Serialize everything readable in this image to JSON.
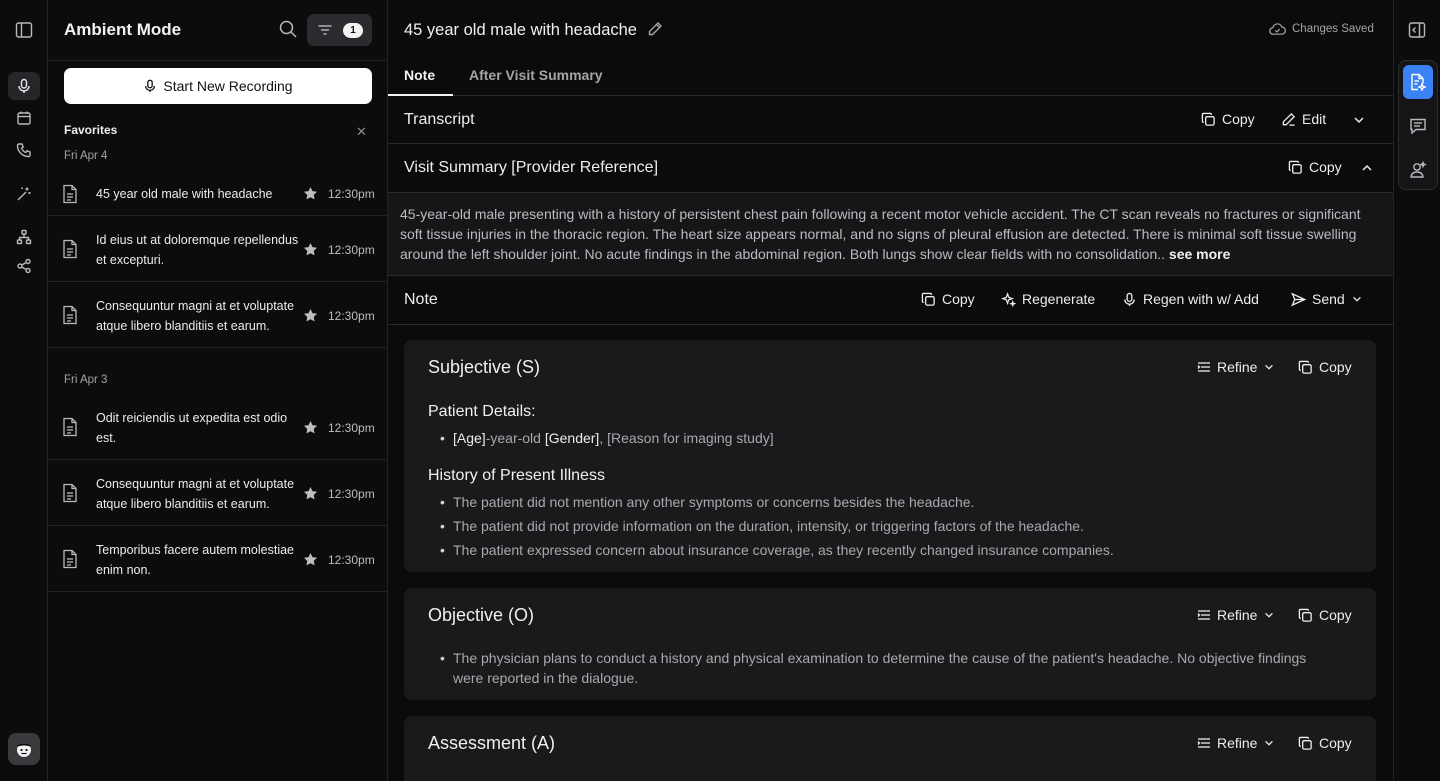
{
  "left_rail": {
    "icons": [
      "sidebar-toggle-icon",
      "microphone-icon",
      "calendar-icon",
      "phone-icon",
      "magic-wand-icon",
      "sitemap-icon",
      "share-icon",
      "avatar-icon"
    ]
  },
  "panel": {
    "title": "Ambient Mode",
    "filter_count": "1",
    "record_button": "Start New Recording",
    "favorites_label": "Favorites",
    "groups": [
      {
        "date": "Fri Apr 4",
        "items": [
          {
            "text": "45 year old male with headache",
            "time": "12:30pm"
          },
          {
            "text": "Id eius ut at doloremque repellendus et excepturi.",
            "time": "12:30pm"
          },
          {
            "text": "Consequuntur magni at et voluptate atque libero blanditiis et earum.",
            "time": "12:30pm"
          }
        ]
      },
      {
        "date": "Fri Apr 3",
        "items": [
          {
            "text": "Odit reiciendis ut expedita est odio est.",
            "time": "12:30pm"
          },
          {
            "text": "Consequuntur magni at et voluptate atque libero blanditiis et earum.",
            "time": "12:30pm"
          },
          {
            "text": "Temporibus facere autem molestiae enim non.",
            "time": "12:30pm"
          }
        ]
      }
    ]
  },
  "main": {
    "title": "45 year old male with headache",
    "saved_status": "Changes Saved",
    "tabs": [
      {
        "label": "Note"
      },
      {
        "label": "After Visit Summary"
      }
    ],
    "transcript": {
      "title": "Transcript",
      "copy": "Copy",
      "edit": "Edit"
    },
    "visit_summary": {
      "title": "Visit Summary [Provider Reference]",
      "copy": "Copy",
      "text": "45-year-old male presenting with a history of persistent chest pain following a recent motor vehicle accident. The CT scan reveals no fractures or significant soft tissue injuries in the thoracic region. The heart size appears normal, and no signs of pleural effusion are detected. There is minimal soft tissue swelling around the left shoulder joint. No acute findings in the abdominal region. Both lungs show clear fields with no consolidation..",
      "see_more": "see more"
    },
    "note": {
      "title": "Note",
      "copy": "Copy",
      "regenerate": "Regenerate",
      "regen_add": "Regen with w/ Add",
      "send": "Send"
    },
    "sections": {
      "subjective": {
        "title": "Subjective (S)",
        "refine": "Refine",
        "copy": "Copy",
        "patient_details_heading": "Patient Details:",
        "patient_age": "[Age]",
        "patient_mid": "-year-old ",
        "patient_gender": "[Gender]",
        "patient_reason": ", [Reason for imaging study]",
        "hpi_heading": "History of Present Illness",
        "hpi": [
          "The patient did not mention any other symptoms or concerns besides the headache.",
          "The patient did not provide information on the duration, intensity, or triggering factors of the headache.",
          "The patient expressed concern about insurance coverage, as they recently changed insurance companies."
        ]
      },
      "objective": {
        "title": "Objective (O)",
        "refine": "Refine",
        "copy": "Copy",
        "bullets": [
          "The physician plans to conduct a history and physical examination to determine the cause of the patient's headache. No objective findings were reported in the dialogue."
        ]
      },
      "assessment": {
        "title": "Assessment (A)",
        "refine": "Refine",
        "copy": "Copy"
      }
    }
  },
  "right_rail": {
    "icons": [
      "collapse-panel-icon",
      "ai-document-icon",
      "chat-icon",
      "assistant-icon"
    ],
    "accent": "#3b82f6"
  }
}
